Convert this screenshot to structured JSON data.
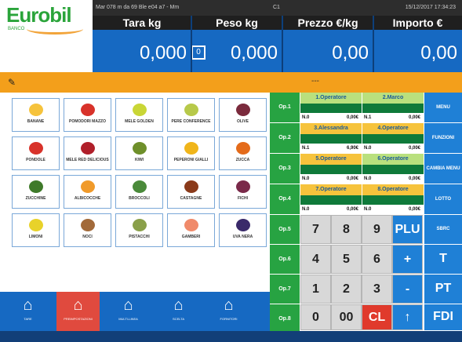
{
  "brand": {
    "name": "Eurobil",
    "sub": "BANCO"
  },
  "topbar": {
    "left": "Mar 078 m da 69 Ble e04 a7 - Mm",
    "mid": "C1",
    "right": "15/12/2017 17:34:23"
  },
  "displays": {
    "tara": {
      "label": "Tara kg",
      "value": "0,000"
    },
    "peso": {
      "label": "Peso kg",
      "value": "0,000",
      "zero_icon": "0"
    },
    "prezzo": {
      "label": "Prezzo €/kg",
      "value": "0,00"
    },
    "importo": {
      "label": "Importo €",
      "value": "0,00"
    }
  },
  "orange_bar": {
    "icon": "pin-icon",
    "text": "---"
  },
  "products": [
    {
      "name": "BANANE",
      "color": "#f6c33c"
    },
    {
      "name": "POMODORI MAZZO",
      "color": "#d8322a"
    },
    {
      "name": "MELE GOLDEN",
      "color": "#c9d636"
    },
    {
      "name": "PERE CONFERENCE",
      "color": "#b7c94a"
    },
    {
      "name": "OLIVE",
      "color": "#7a2a3c"
    },
    {
      "name": "PONDOLE",
      "color": "#d8322a"
    },
    {
      "name": "MELE RED DELICIOUS",
      "color": "#b01f2a"
    },
    {
      "name": "KIWI",
      "color": "#6e8f2a"
    },
    {
      "name": "PEPERONI GIALLI",
      "color": "#f0b51a"
    },
    {
      "name": "ZUCCA",
      "color": "#e46b1a"
    },
    {
      "name": "ZUCCHINE",
      "color": "#3f7a2a"
    },
    {
      "name": "ALBICOCCHE",
      "color": "#f09a2a"
    },
    {
      "name": "BROCCOLI",
      "color": "#4a8a3a"
    },
    {
      "name": "CASTAGNE",
      "color": "#8a3a1a"
    },
    {
      "name": "FICHI",
      "color": "#7a2a4a"
    },
    {
      "name": "LIMONI",
      "color": "#e8d22a"
    },
    {
      "name": "NOCI",
      "color": "#a26a3a"
    },
    {
      "name": "PISTACCHI",
      "color": "#8aa04a"
    },
    {
      "name": "GAMBERI",
      "color": "#f08a6a"
    },
    {
      "name": "UVA NERA",
      "color": "#3a2a6a"
    }
  ],
  "bottom_nav": [
    {
      "label": "TARE",
      "active": false
    },
    {
      "label": "PREIMPOSTAZIONI",
      "active": true
    },
    {
      "label": "MULTI-LINEA",
      "active": false
    },
    {
      "label": "SCELTA",
      "active": false
    },
    {
      "label": "FORNITORI",
      "active": false
    }
  ],
  "op_labels": [
    "Op.1",
    "Op.2",
    "Op.3",
    "Op.4",
    "Op.5",
    "Op.6",
    "Op.7",
    "Op.8"
  ],
  "operators": [
    {
      "name": "1.Operatore",
      "n": "N.0",
      "amount": "0,00€",
      "highlight": false
    },
    {
      "name": "2.Marco",
      "n": "N.1",
      "amount": "0,00€",
      "highlight": false
    },
    {
      "name": "3.Alessandra",
      "n": "N.1",
      "amount": "6,90€",
      "highlight": true
    },
    {
      "name": "4.Operatore",
      "n": "N.0",
      "amount": "0,00€",
      "highlight": true
    },
    {
      "name": "5.Operatore",
      "n": "N.0",
      "amount": "0,00€",
      "highlight": true
    },
    {
      "name": "6.Operatore",
      "n": "N.0",
      "amount": "0,00€",
      "highlight": false
    },
    {
      "name": "7.Operatore",
      "n": "N.0",
      "amount": "0,00€",
      "highlight": true
    },
    {
      "name": "8.Operatore",
      "n": "N.0",
      "amount": "0,00€",
      "highlight": true
    }
  ],
  "right_buttons": [
    "MENU",
    "FUNZIONI",
    "CAMBIA MENU",
    "LOTTO",
    "SBRC"
  ],
  "keypad": [
    {
      "label": "7",
      "style": ""
    },
    {
      "label": "8",
      "style": ""
    },
    {
      "label": "9",
      "style": ""
    },
    {
      "label": "PLU",
      "style": "blue"
    },
    {
      "label": "4",
      "style": ""
    },
    {
      "label": "5",
      "style": ""
    },
    {
      "label": "6",
      "style": ""
    },
    {
      "label": "+",
      "style": "blue"
    },
    {
      "label": "1",
      "style": ""
    },
    {
      "label": "2",
      "style": ""
    },
    {
      "label": "3",
      "style": ""
    },
    {
      "label": "-",
      "style": "blue"
    },
    {
      "label": "0",
      "style": ""
    },
    {
      "label": "00",
      "style": ""
    },
    {
      "label": "CL",
      "style": "red"
    },
    {
      "label": "↑",
      "style": "blue"
    }
  ],
  "func_keys": [
    "T",
    "PT",
    "FDI"
  ]
}
